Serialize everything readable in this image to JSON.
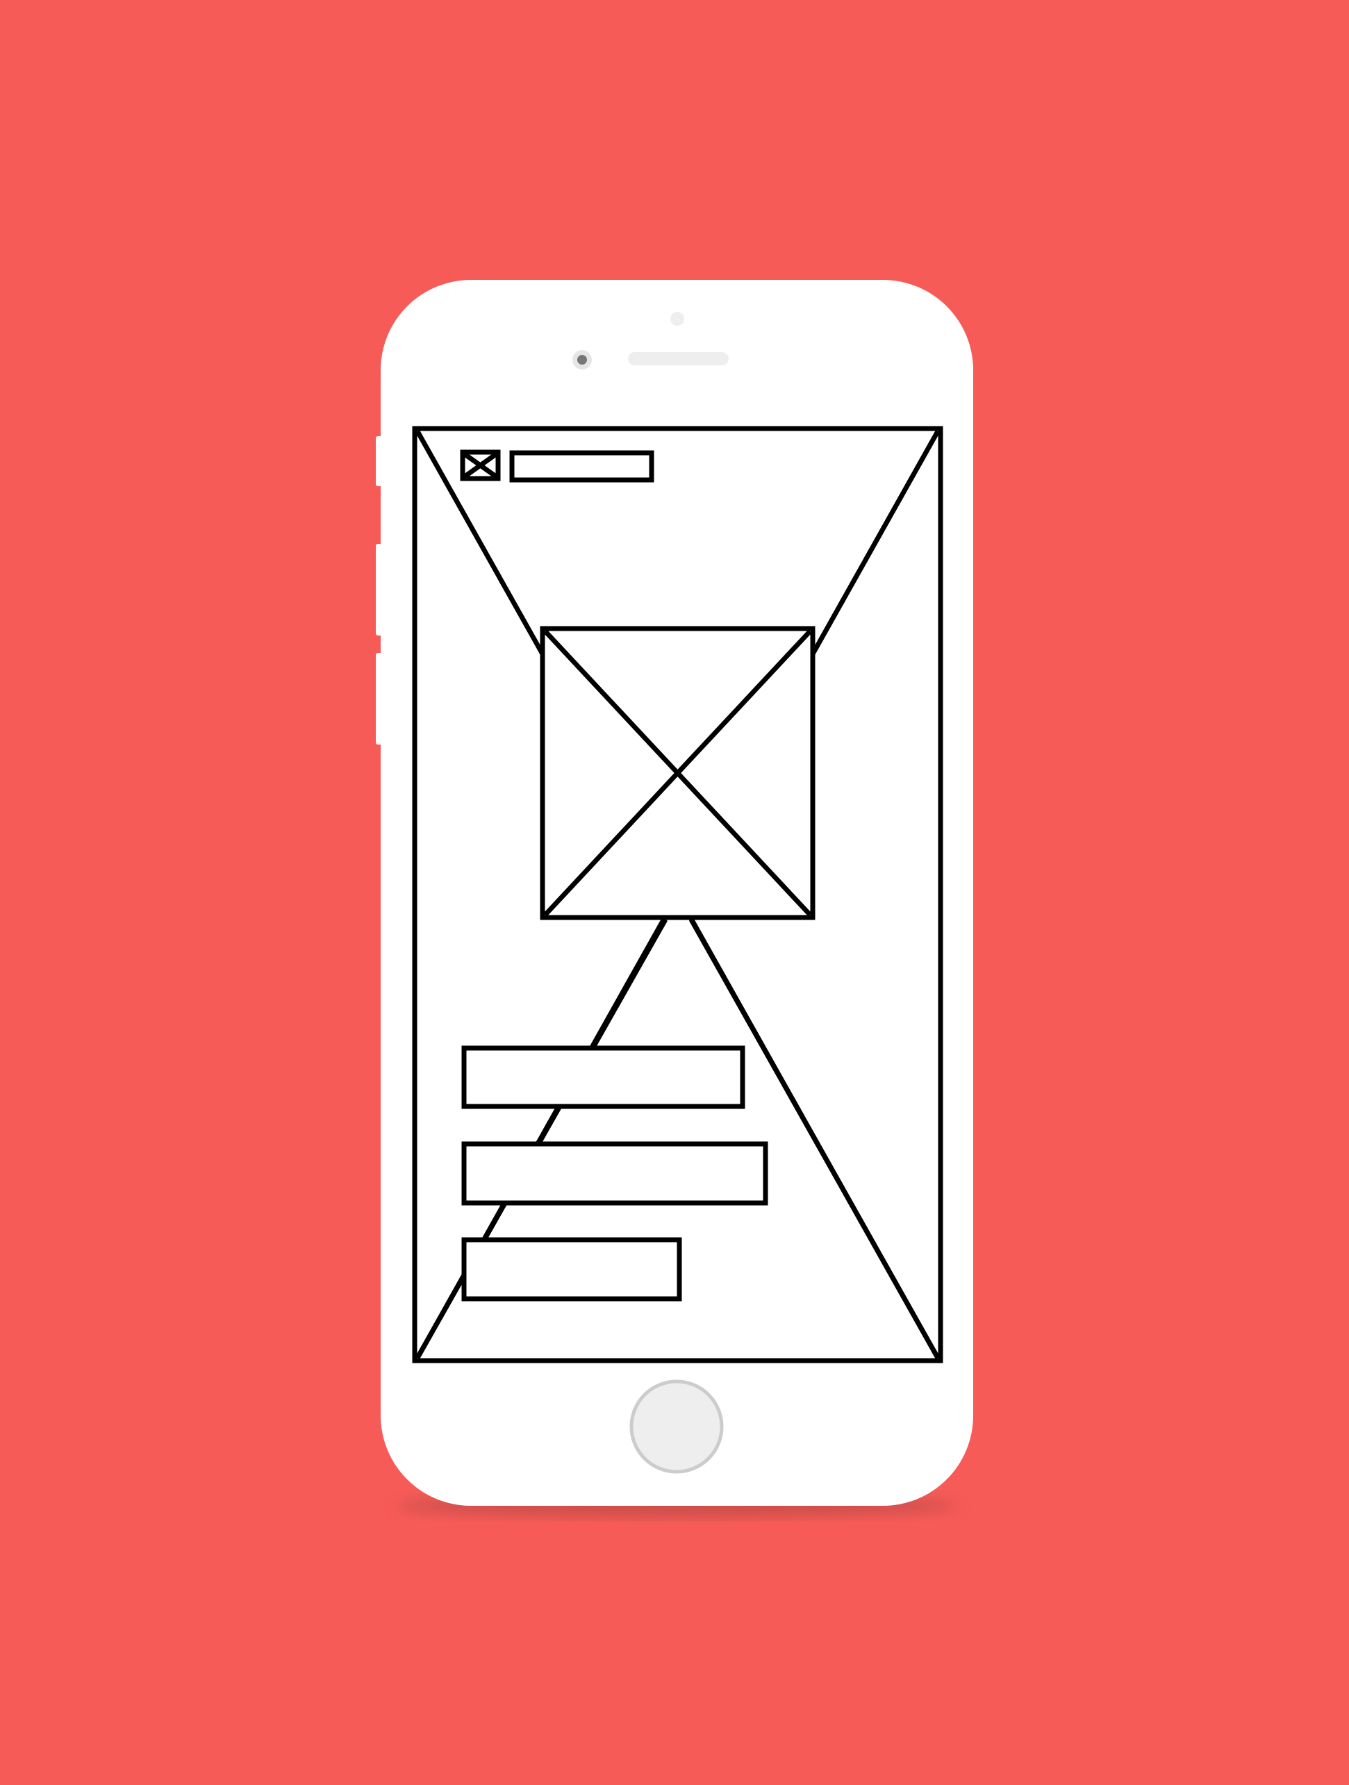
{
  "colors": {
    "background": "#F75B58",
    "phone_body": "#FFFFFF",
    "phone_shadow": "#B84845",
    "side_button": "#FFFFFF",
    "wireframe_stroke": "#000000",
    "screen": "#FFFFFF",
    "speaker": "#EEEEEE",
    "sensor": "#EEEEEE",
    "front_camera_ring": "#E6E6E6",
    "front_camera_lens": "#777777",
    "home_button_fill": "#EEEEEE",
    "home_button_ring": "#CCCCCC"
  },
  "phone": {
    "side_buttons": [
      "mute-switch",
      "volume-up-button",
      "volume-down-button"
    ],
    "top_details": [
      "proximity-sensor",
      "front-camera",
      "earpiece-speaker"
    ],
    "home_button": "home-button"
  },
  "wireframe": {
    "screen_placeholder": "full-screen-image-placeholder",
    "header": {
      "icon": "image-placeholder-icon",
      "title_bar": "title-text-placeholder"
    },
    "hero_image": "hero-image-placeholder",
    "text_lines": [
      "text-line-1",
      "text-line-2",
      "text-line-3"
    ]
  }
}
